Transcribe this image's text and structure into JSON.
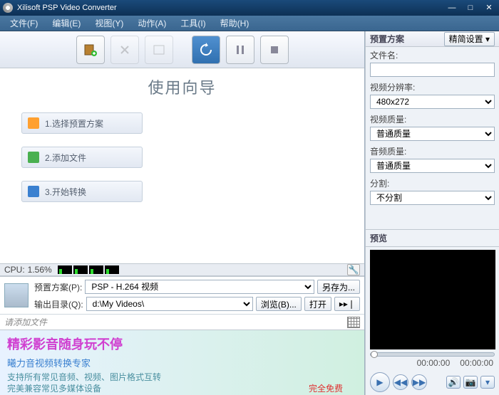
{
  "window": {
    "title": "Xilisoft PSP Video Converter"
  },
  "menu": {
    "file": "文件(F)",
    "edit": "编辑(E)",
    "view": "视图(Y)",
    "action": "动作(A)",
    "tools": "工具(I)",
    "help": "帮助(H)"
  },
  "wizard": {
    "title": "使用向导",
    "step1": "1.选择预置方案",
    "step2": "2.添加文件",
    "step3": "3.开始转换"
  },
  "cpu": {
    "label": "CPU:",
    "value": "1.56%"
  },
  "profile": {
    "label": "预置方案(P):",
    "value": "PSP - H.264 视频",
    "save_as": "另存为..."
  },
  "output": {
    "label": "输出目录(Q):",
    "value": "d:\\My Videos\\",
    "browse": "浏览(B)...",
    "open": "打开"
  },
  "add_hint": "请添加文件",
  "right": {
    "profile_title": "预置方案",
    "advanced": "精简设置",
    "file_name": "文件名:",
    "resolution": "视频分辨率:",
    "resolution_val": "480x272",
    "vquality": "视频质量:",
    "vquality_val": "普通质量",
    "aquality": "音频质量:",
    "aquality_val": "普通质量",
    "split": "分割:",
    "split_val": "不分割"
  },
  "preview": {
    "title": "预览",
    "time1": "00:00:00",
    "time2": "00:00:00"
  },
  "banner": {
    "h1": "精彩影音随身玩不停",
    "h2": "曦力音视频转换专家",
    "d1": "支持所有常见音频、视频、图片格式互转",
    "d2": "完美兼容常见多媒体设备",
    "free": "完全免费"
  }
}
